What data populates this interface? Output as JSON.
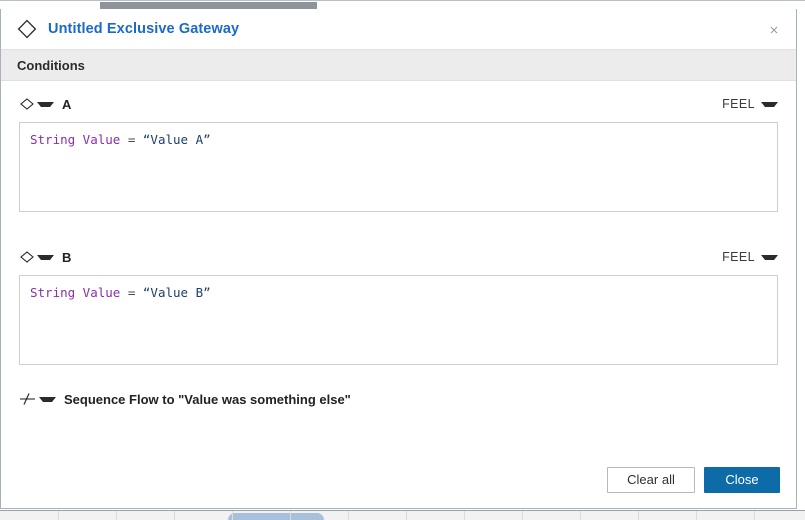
{
  "window": {
    "title": "Untitled Exclusive Gateway",
    "title_icon": "exclusive-gateway-diamond-icon",
    "close_label": "×"
  },
  "section": {
    "header_label": "Conditions"
  },
  "conditions": [
    {
      "icon": "sequence-flow-diamond-icon",
      "name": "A",
      "language": "FEEL",
      "expression": {
        "variable": "String Value",
        "operator": "=",
        "value": "“Value A”"
      }
    },
    {
      "icon": "sequence-flow-diamond-icon",
      "name": "B",
      "language": "FEEL",
      "expression": {
        "variable": "String Value",
        "operator": "=",
        "value": "“Value B”"
      }
    }
  ],
  "default_flow": {
    "icon": "default-sequence-flow-icon",
    "label": "Sequence Flow to \"Value was something else\""
  },
  "footer": {
    "clear_all_label": "Clear all",
    "close_label": "Close"
  },
  "colors": {
    "accent_blue": "#0d6ba8",
    "title_blue": "#1b6ac9",
    "section_bar": "#ececec",
    "token_variable": "#8b2fa8",
    "token_string": "#1d3f6b"
  }
}
